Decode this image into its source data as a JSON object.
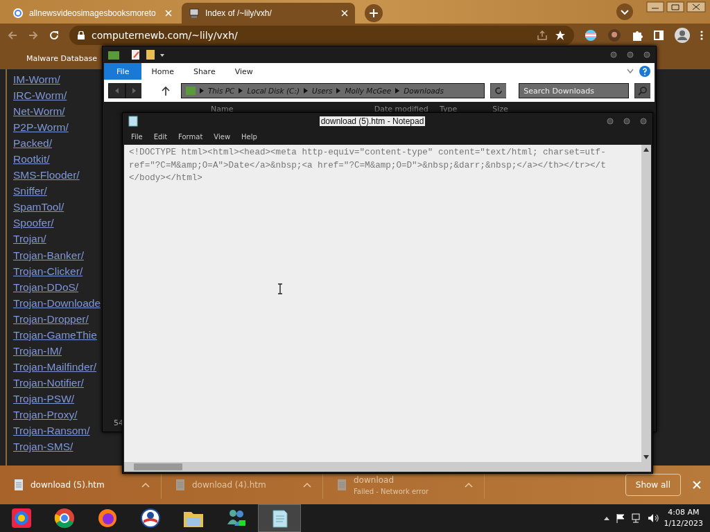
{
  "browser": {
    "tabs": [
      {
        "title": "allnewsvideosimagesbooksmoreto",
        "selected": false
      },
      {
        "title": "Index of /~lily/vxh/",
        "selected": true
      }
    ],
    "address": "computernewb.com/~lily/vxh/",
    "bookmarks": [
      "Malware Database"
    ]
  },
  "page": {
    "links": [
      "IM-Worm/",
      "IRC-Worm/",
      "Net-Worm/",
      "P2P-Worm/",
      "Packed/",
      "Rootkit/",
      "SMS-Flooder/",
      "Sniffer/",
      "SpamTool/",
      "Spoofer/",
      "Trojan/",
      "Trojan-Banker/",
      "Trojan-Clicker/",
      "Trojan-DDoS/",
      "Trojan-Downloade",
      "Trojan-Dropper/",
      "Trojan-GameThie",
      "Trojan-IM/",
      "Trojan-Mailfinder/",
      "Trojan-Notifier/",
      "Trojan-PSW/",
      "Trojan-Proxy/",
      "Trojan-Ransom/",
      "Trojan-SMS/"
    ]
  },
  "explorer": {
    "ribbon_tabs": [
      {
        "label": "File",
        "selected": true
      },
      {
        "label": "Home",
        "selected": false
      },
      {
        "label": "Share",
        "selected": false
      },
      {
        "label": "View",
        "selected": false
      }
    ],
    "breadcrumb": [
      "This PC",
      "Local Disk (C:)",
      "Users",
      "Molly McGee",
      "Downloads"
    ],
    "search": {
      "placeholder": "Search Downloads"
    },
    "columns": [
      "Name",
      "Date modified",
      "Type",
      "Size"
    ],
    "status": "54"
  },
  "notepad": {
    "title": "download (5).htm - Notepad",
    "menu": [
      "File",
      "Edit",
      "Format",
      "View",
      "Help"
    ],
    "lines": [
      "<!DOCTYPE html><html><head><meta http-equiv=\"content-type\" content=\"text/html; charset=utf-",
      "ref=\"?C=M&amp;O=A\">Date</a>&nbsp;<a href=\"?C=M&amp;O=D\">&nbsp;&darr;&nbsp;</a></th></tr></t",
      "</body></html>"
    ]
  },
  "downloads": {
    "items": [
      {
        "name": "download (5).htm",
        "dimmed": false
      },
      {
        "name": "download (4).htm",
        "dimmed": true
      },
      {
        "name": "download",
        "status": "Failed - Network error",
        "dimmed": true
      }
    ],
    "show_all": "Show all"
  },
  "taskbar": {
    "apps": [
      {
        "kind": "chromium",
        "selected": false
      },
      {
        "kind": "chrome",
        "selected": false
      },
      {
        "kind": "firefox",
        "selected": false
      },
      {
        "kind": "logo",
        "selected": false
      },
      {
        "kind": "folder",
        "selected": false
      },
      {
        "kind": "people",
        "selected": false
      },
      {
        "kind": "notepad",
        "selected": true
      }
    ],
    "time": "4:08 AM",
    "date": "1/12/2023"
  }
}
